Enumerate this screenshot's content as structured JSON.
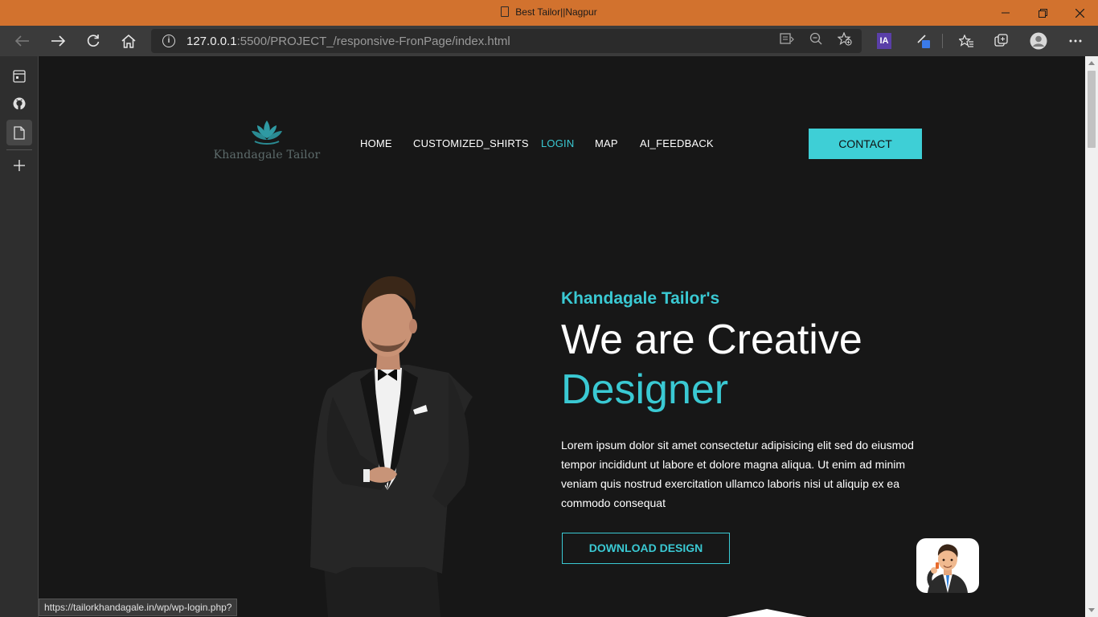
{
  "window": {
    "title": "Best Tailor||Nagpur",
    "controls": [
      "minimize",
      "restore",
      "close"
    ]
  },
  "browser": {
    "url_host": "127.0.0.1",
    "url_rest": ":5500/PROJECT_/responsive-FronPage/index.html",
    "extension_label": "IA",
    "status_url": "https://tailorkhandagale.in/wp/wp-login.php?"
  },
  "site": {
    "logo_text": "Khandagale Tailor",
    "nav": [
      "HOME",
      "CUSTOMIZED_SHIRTS",
      "LOGIN",
      "MAP",
      "AI_FEEDBACK"
    ],
    "active_nav": "LOGIN",
    "contact_label": "CONTACT",
    "accent_color": "#3ac9d3"
  },
  "hero": {
    "eyebrow": "Khandagale Tailor's",
    "heading": "We are Creative",
    "heading_accent": "Designer",
    "description": "Lorem ipsum dolor sit amet consectetur adipisicing elit sed do eiusmod tempor incididunt ut labore et dolore magna aliqua. Ut enim ad minim veniam quis nostrud exercitation ullamco laboris nisi ut aliquip ex ea commodo consequat",
    "cta_label": "DOWNLOAD DESIGN"
  }
}
